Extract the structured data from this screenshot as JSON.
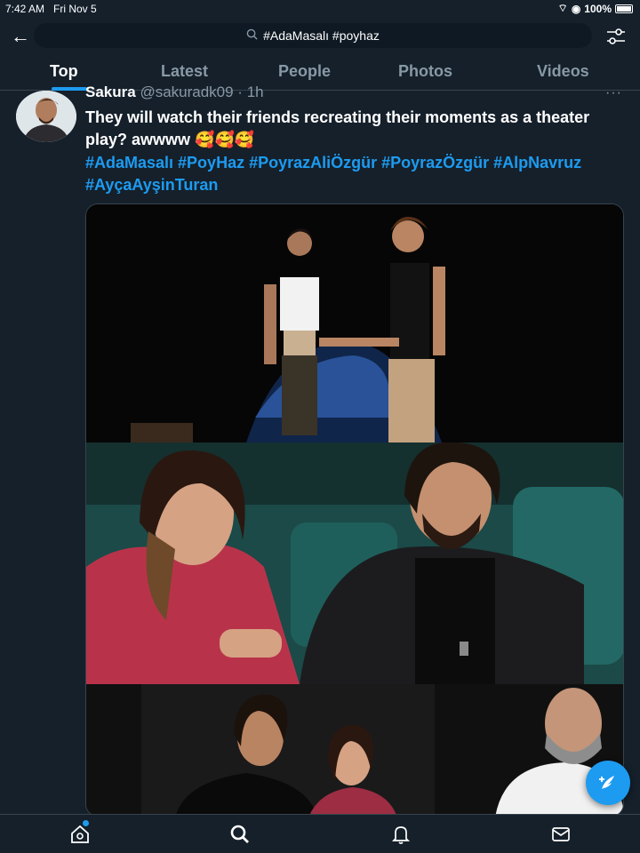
{
  "status_bar": {
    "time": "7:42 AM",
    "date": "Fri Nov 5",
    "battery": "100%"
  },
  "search": {
    "query": "#AdaMasalı #poyhaz"
  },
  "tabs": [
    {
      "label": "Top",
      "active": true
    },
    {
      "label": "Latest",
      "active": false
    },
    {
      "label": "People",
      "active": false
    },
    {
      "label": "Photos",
      "active": false
    },
    {
      "label": "Videos",
      "active": false
    }
  ],
  "tweet": {
    "author_name": "Sakura",
    "author_handle": "@sakuradk09 · 1h",
    "text": "They will watch their friends recreating their moments as a theater play? awwww 🥰🥰🥰",
    "hashtags_line1": "#AdaMasalı #PoyHaz #PoyrazAliÖzgür #PoyrazÖzgür #AlpNavruz",
    "hashtags_line2": "#AyçaAyşinTuran"
  },
  "colors": {
    "background": "#15202b",
    "accent": "#1d9bf0",
    "muted": "#8899a6",
    "divider": "#38444d"
  },
  "icons": {
    "back": "arrow-left-icon",
    "search": "search-icon",
    "filter": "sliders-icon",
    "more": "more-icon",
    "compose": "compose-icon",
    "nav": [
      "home-icon",
      "search-icon",
      "bell-icon",
      "mail-icon"
    ]
  }
}
